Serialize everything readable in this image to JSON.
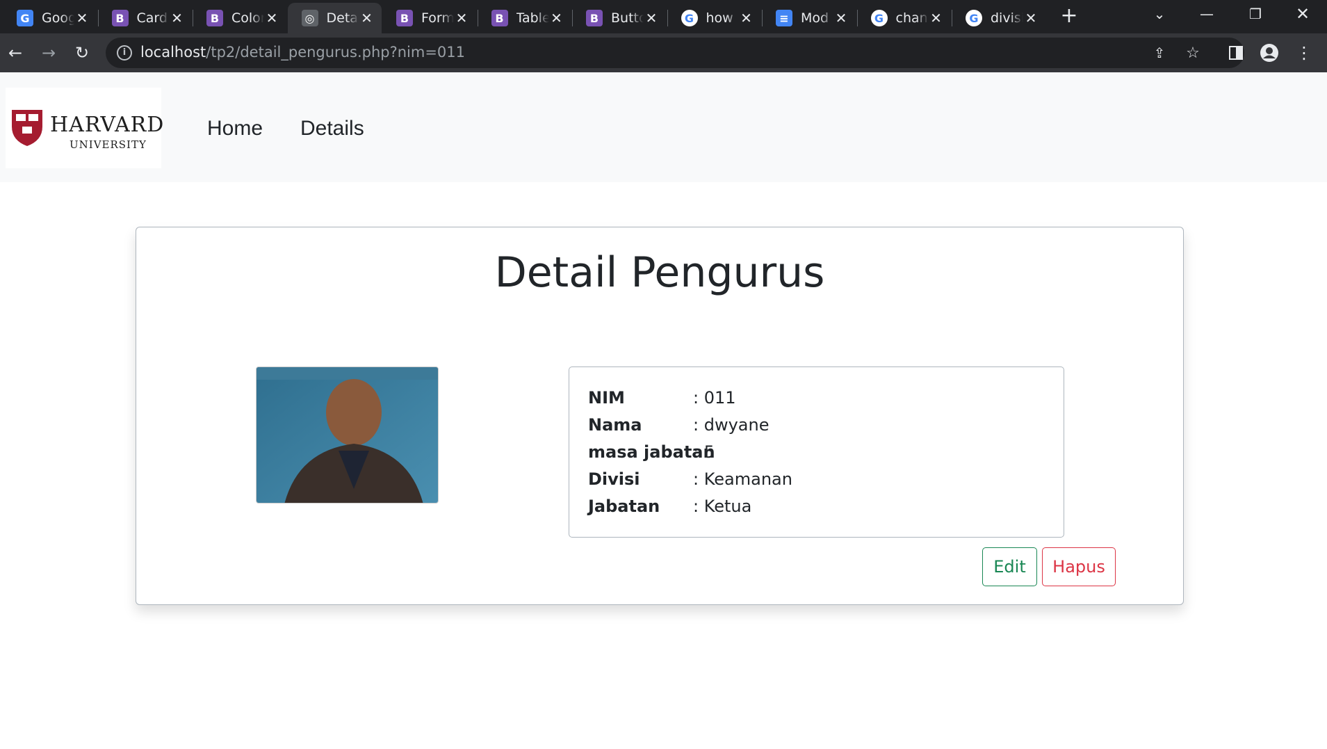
{
  "browser": {
    "tabs": [
      {
        "title": "Goog",
        "icon": "google-translate-icon",
        "color": "#4285f4",
        "glyph": "G"
      },
      {
        "title": "Card",
        "icon": "bootstrap-icon",
        "color": "#7952b3",
        "glyph": "B"
      },
      {
        "title": "Color",
        "icon": "bootstrap-icon",
        "color": "#7952b3",
        "glyph": "B"
      },
      {
        "title": "Detai",
        "icon": "harvard-favicon-icon",
        "color": "#5f6368",
        "glyph": "◎"
      },
      {
        "title": "Form",
        "icon": "bootstrap-icon",
        "color": "#7952b3",
        "glyph": "B"
      },
      {
        "title": "Table",
        "icon": "bootstrap-icon",
        "color": "#7952b3",
        "glyph": "B"
      },
      {
        "title": "Butto",
        "icon": "bootstrap-icon",
        "color": "#7952b3",
        "glyph": "B"
      },
      {
        "title": "how",
        "icon": "google-icon",
        "color": "#ffffff",
        "glyph": "G"
      },
      {
        "title": "Mod",
        "icon": "google-docs-icon",
        "color": "#4285f4",
        "glyph": "≡"
      },
      {
        "title": "chan",
        "icon": "google-icon",
        "color": "#ffffff",
        "glyph": "G"
      },
      {
        "title": "divisi",
        "icon": "google-icon",
        "color": "#ffffff",
        "glyph": "G"
      }
    ],
    "active_tab": 3,
    "url_host": "localhost",
    "url_path": "/tp2/detail_pengurus.php?nim=011"
  },
  "navbar": {
    "logo_title": "HARVARD",
    "logo_subtitle": "UNIVERSITY",
    "links": [
      "Home",
      "Details"
    ]
  },
  "detail": {
    "heading": "Detail Pengurus",
    "fields": [
      {
        "label": "NIM",
        "value": ": 011"
      },
      {
        "label": "Nama",
        "value": ": dwyane"
      },
      {
        "label": "masa jabatan",
        "value": ": 5"
      },
      {
        "label": "Divisi",
        "value": ": Keamanan"
      },
      {
        "label": "Jabatan",
        "value": ": Ketua"
      }
    ],
    "edit_label": "Edit",
    "delete_label": "Hapus"
  },
  "colors": {
    "edit": "#198754",
    "delete": "#dc3545",
    "harvard_crimson": "#a51c30"
  }
}
